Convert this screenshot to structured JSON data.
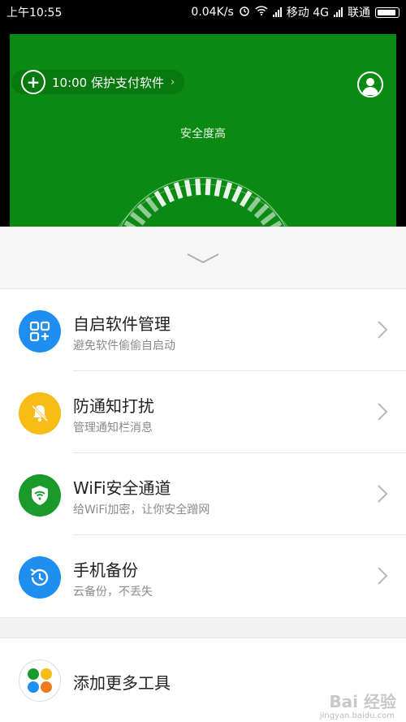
{
  "status_bar": {
    "time": "上午10:55",
    "speed": "0.04K/s",
    "carrier1": "移动 4G",
    "carrier2": "联通"
  },
  "header": {
    "protect_text": "10:00 保护支付软件",
    "safety_label": "安全度高"
  },
  "items": [
    {
      "title": "自启软件管理",
      "subtitle": "避免软件偷偷自启动",
      "color": "#1e8ef0",
      "icon": "app-grid-icon"
    },
    {
      "title": "防通知打扰",
      "subtitle": "管理通知栏消息",
      "color": "#f7bc16",
      "icon": "bell-off-icon"
    },
    {
      "title": "WiFi安全通道",
      "subtitle": "给WiFi加密，让你安全蹭网",
      "color": "#1b9a2c",
      "icon": "wifi-shield-icon"
    },
    {
      "title": "手机备份",
      "subtitle": "云备份，不丢失",
      "color": "#1e8ef0",
      "icon": "backup-clock-icon"
    }
  ],
  "add_tools": {
    "title": "添加更多工具"
  },
  "watermark": {
    "text": "Bai 经验",
    "sub": "jingyan.baidu.com"
  },
  "colors": {
    "green": "#0a8a12"
  }
}
